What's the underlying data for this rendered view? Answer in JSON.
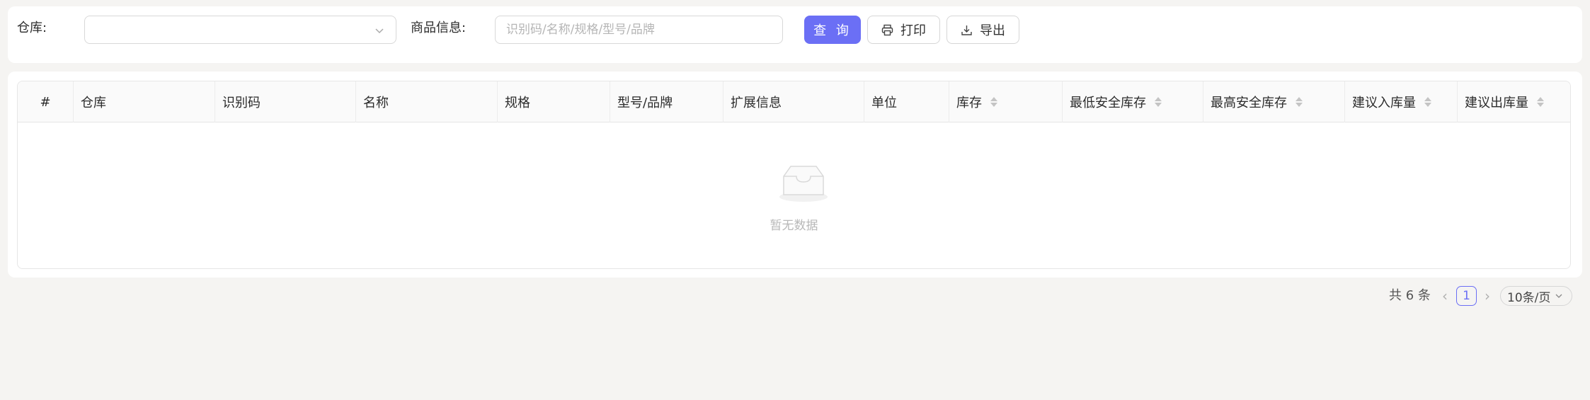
{
  "filters": {
    "warehouse_label": "仓库:",
    "warehouse_value": "",
    "product_label": "商品信息:",
    "product_placeholder": "识别码/名称/规格/型号/品牌",
    "query_button": "查 询",
    "print_button": "打印",
    "export_button": "导出",
    "icons": {
      "select": "chevron-down-icon",
      "print": "printer-icon",
      "export": "download-icon"
    }
  },
  "table": {
    "columns": [
      {
        "key": "index",
        "label": "#"
      },
      {
        "key": "warehouse",
        "label": "仓库"
      },
      {
        "key": "code",
        "label": "识别码"
      },
      {
        "key": "name",
        "label": "名称"
      },
      {
        "key": "spec",
        "label": "规格"
      },
      {
        "key": "model_brand",
        "label": "型号/品牌"
      },
      {
        "key": "extra",
        "label": "扩展信息"
      },
      {
        "key": "unit",
        "label": "单位"
      },
      {
        "key": "stock",
        "label": "库存",
        "sortable": true
      },
      {
        "key": "min_safe",
        "label": "最低安全库存",
        "sortable": true
      },
      {
        "key": "max_safe",
        "label": "最高安全库存",
        "sortable": true
      },
      {
        "key": "suggest_in",
        "label": "建议入库量",
        "sortable": true
      },
      {
        "key": "suggest_out",
        "label": "建议出库量",
        "sortable": true
      }
    ],
    "rows": [],
    "empty_text": "暂无数据",
    "empty_icon": "empty-inbox-icon"
  },
  "pagination": {
    "total_text": "共 6 条",
    "current_page": "1",
    "page_size": "10条/页",
    "prev_icon": "chevron-left-icon",
    "next_icon": "chevron-right-icon"
  },
  "colors": {
    "primary": "#6b6ff5",
    "background": "#f5f4f2",
    "card": "#ffffff"
  }
}
